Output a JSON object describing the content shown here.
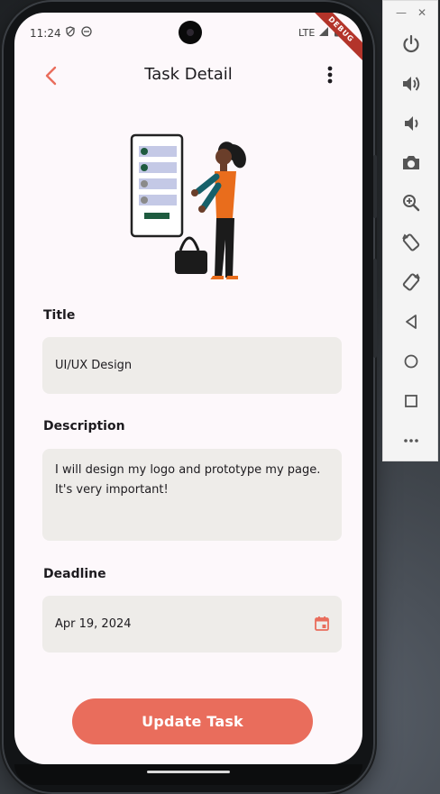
{
  "status_bar": {
    "time": "11:24",
    "network": "LTE",
    "debug_banner": "DEBUG"
  },
  "app_bar": {
    "title": "Task Detail"
  },
  "form": {
    "title_label": "Title",
    "title_value": "UI/UX Design",
    "description_label": "Description",
    "description_value": "I will design my logo and prototype my page. It's very important!",
    "deadline_label": "Deadline",
    "deadline_value": "Apr 19, 2024"
  },
  "actions": {
    "update_label": "Update Task"
  },
  "colors": {
    "accent": "#E96D5C",
    "field_bg": "#EEECE9",
    "screen_bg": "#FDF8FB"
  },
  "emulator_toolbar": {
    "window_controls": [
      "minimize",
      "close"
    ],
    "buttons": [
      "power-icon",
      "volume-up-icon",
      "volume-down-icon",
      "camera-icon",
      "zoom-icon",
      "rotate-left-icon",
      "rotate-right-icon",
      "back-icon",
      "home-icon",
      "overview-icon",
      "more-icon"
    ]
  }
}
